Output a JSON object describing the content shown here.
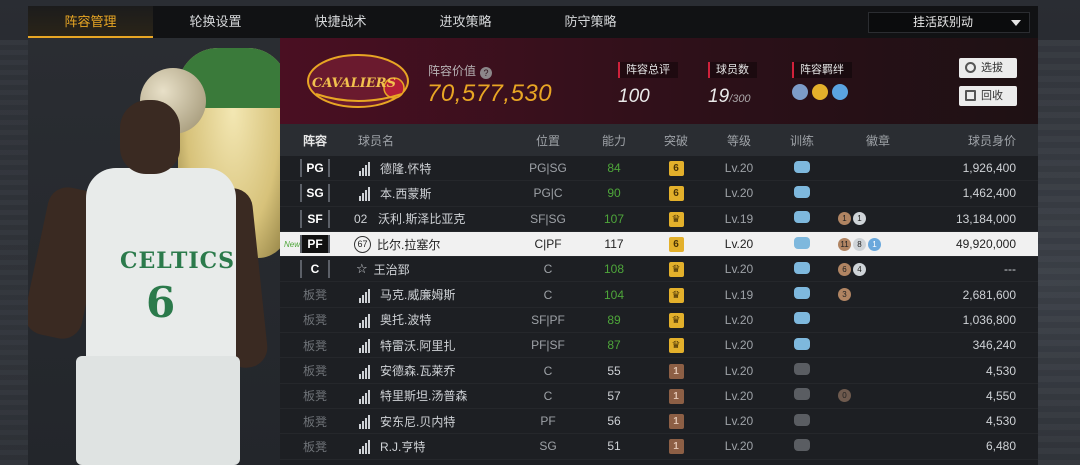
{
  "tabs": [
    {
      "label": "阵容管理",
      "active": true
    },
    {
      "label": "轮换设置",
      "active": false
    },
    {
      "label": "快捷战术",
      "active": false
    },
    {
      "label": "进攻策略",
      "active": false
    },
    {
      "label": "防守策略",
      "active": false
    }
  ],
  "dropdown": {
    "value": "挂活跃别动"
  },
  "portrait": {
    "jersey_text": "CELTICS",
    "jersey_number": "6"
  },
  "header": {
    "logo_text": "CAVALIERS",
    "value_label": "阵容价值",
    "value_amount": "70,577,530",
    "rating_label": "阵容总评",
    "rating_value": "100",
    "players_label": "球员数",
    "players_value": "19",
    "players_max": "/300",
    "chem_label": "阵容羁绊",
    "select_button": "选拔",
    "return_button": "回收"
  },
  "columns": [
    "阵容",
    "球员名",
    "位置",
    "能力",
    "突破",
    "等级",
    "训练",
    "徽章",
    "球员身价"
  ],
  "rows": [
    {
      "pos": "PG",
      "prefix": "bars",
      "name": "德隆.怀特",
      "slot": "PG|SG",
      "ovr": "84",
      "ovr_green": true,
      "brk": "6",
      "brk_type": "gold",
      "lv": "Lv.20",
      "train": "blue",
      "badges": [],
      "salary": "1,926,400"
    },
    {
      "pos": "SG",
      "prefix": "bars",
      "name": "本.西蒙斯",
      "slot": "PG|C",
      "ovr": "90",
      "ovr_green": true,
      "brk": "6",
      "brk_type": "gold",
      "lv": "Lv.20",
      "train": "blue",
      "badges": [],
      "salary": "1,462,400"
    },
    {
      "pos": "SF",
      "prefix": "02",
      "name": "沃利.斯泽比亚克",
      "slot": "SF|SG",
      "ovr": "107",
      "ovr_green": true,
      "brk": "♛",
      "brk_type": "gold",
      "lv": "Lv.19",
      "train": "blue",
      "badges": [
        {
          "t": "1",
          "c": "bronze"
        },
        {
          "t": "1",
          "c": "silver"
        }
      ],
      "salary": "13,184,000"
    },
    {
      "pos": "PF",
      "prefix": "67",
      "name": "比尔.拉塞尔",
      "slot": "C|PF",
      "ovr": "117",
      "ovr_green": false,
      "brk": "6",
      "brk_type": "gold",
      "lv": "Lv.20",
      "train": "blue",
      "badges": [
        {
          "t": "11",
          "c": "bronze"
        },
        {
          "t": "8",
          "c": "silver"
        },
        {
          "t": "1",
          "c": "blue"
        }
      ],
      "salary": "49,920,000",
      "selected": true,
      "new": "New"
    },
    {
      "pos": "C",
      "prefix": "star",
      "name": "王治郅",
      "slot": "C",
      "ovr": "108",
      "ovr_green": true,
      "brk": "♛",
      "brk_type": "gold",
      "lv": "Lv.20",
      "train": "blue",
      "badges": [
        {
          "t": "6",
          "c": "bronze"
        },
        {
          "t": "4",
          "c": "silver"
        }
      ],
      "salary": "---"
    },
    {
      "pos": "板凳",
      "prefix": "bars",
      "name": "马克.威廉姆斯",
      "slot": "C",
      "ovr": "104",
      "ovr_green": true,
      "brk": "♛",
      "brk_type": "gold",
      "lv": "Lv.19",
      "train": "blue",
      "badges": [
        {
          "t": "3",
          "c": "bronze"
        }
      ],
      "salary": "2,681,600"
    },
    {
      "pos": "板凳",
      "prefix": "bars",
      "name": "奥托.波特",
      "slot": "SF|PF",
      "ovr": "89",
      "ovr_green": true,
      "brk": "♛",
      "brk_type": "gold",
      "lv": "Lv.20",
      "train": "blue",
      "badges": [],
      "salary": "1,036,800"
    },
    {
      "pos": "板凳",
      "prefix": "bars",
      "name": "特雷沃.阿里扎",
      "slot": "PF|SF",
      "ovr": "87",
      "ovr_green": true,
      "brk": "♛",
      "brk_type": "gold",
      "lv": "Lv.20",
      "train": "blue",
      "badges": [],
      "salary": "346,240"
    },
    {
      "pos": "板凳",
      "prefix": "bars",
      "name": "安德森.瓦莱乔",
      "slot": "C",
      "ovr": "55",
      "ovr_green": false,
      "brk": "1",
      "brk_type": "bronze",
      "lv": "Lv.20",
      "train": "dim",
      "badges": [],
      "salary": "4,530"
    },
    {
      "pos": "板凳",
      "prefix": "bars",
      "name": "特里斯坦.汤普森",
      "slot": "C",
      "ovr": "57",
      "ovr_green": false,
      "brk": "1",
      "brk_type": "bronze",
      "lv": "Lv.20",
      "train": "dim",
      "badges": [
        {
          "t": "0",
          "c": "dim"
        }
      ],
      "salary": "4,550"
    },
    {
      "pos": "板凳",
      "prefix": "bars",
      "name": "安东尼.贝内特",
      "slot": "PF",
      "ovr": "56",
      "ovr_green": false,
      "brk": "1",
      "brk_type": "bronze",
      "lv": "Lv.20",
      "train": "dim",
      "badges": [],
      "salary": "4,530"
    },
    {
      "pos": "板凳",
      "prefix": "bars",
      "name": "R.J.亨特",
      "slot": "SG",
      "ovr": "51",
      "ovr_green": false,
      "brk": "1",
      "brk_type": "bronze",
      "lv": "Lv.20",
      "train": "dim",
      "badges": [],
      "salary": "6,480"
    }
  ]
}
